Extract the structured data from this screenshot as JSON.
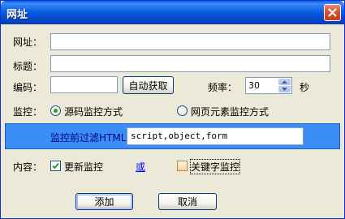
{
  "window": {
    "title": "网址"
  },
  "fields": {
    "url_label": "网址：",
    "url_value": "",
    "title_label": "标题：",
    "title_value": "",
    "encoding_label": "编码：",
    "encoding_value": "",
    "auto_detect_button": "自动获取",
    "frequency_label": "频率：",
    "frequency_value": "30",
    "frequency_unit": "秒"
  },
  "monitor": {
    "label": "监控：",
    "option_source": "源码监控方式",
    "option_source_checked": true,
    "option_element": "网页元素监控方式",
    "option_element_checked": false,
    "filter_label": "监控前过滤HTML",
    "filter_value": "script,object,form"
  },
  "content": {
    "label": "内容：",
    "update_monitor": "更新监控",
    "update_monitor_checked": true,
    "or_link": "或",
    "keyword_monitor": "关键字监控",
    "keyword_monitor_checked": false
  },
  "buttons": {
    "add": "添加",
    "cancel": "取消"
  }
}
